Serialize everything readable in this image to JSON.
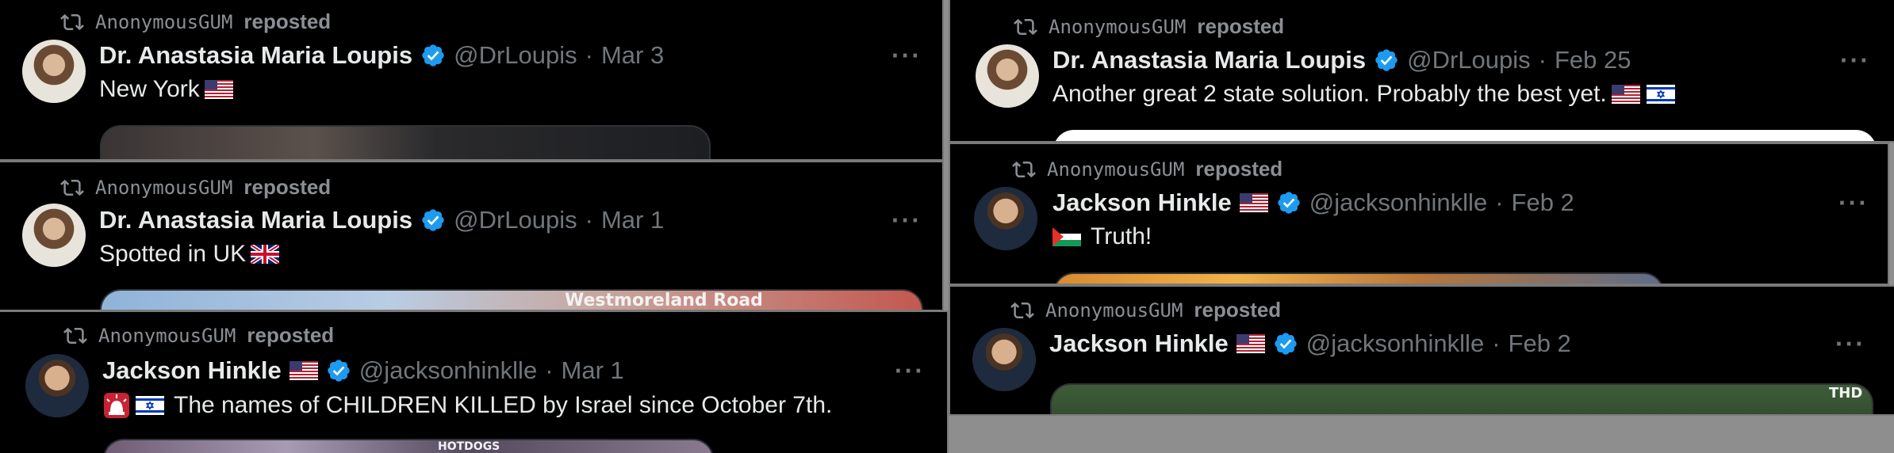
{
  "colors": {
    "background": "#000000",
    "name": "#e7e9ea",
    "secondary": "#71767b",
    "verified": "#1d9bf0"
  },
  "tweets": [
    {
      "reposter": "AnonymousGUM",
      "repost_label": "reposted",
      "author": "Dr. Anastasia Maria Loupis",
      "author_flag": "",
      "handle": "@DrLoupis",
      "separator": "·",
      "date": "Mar 3",
      "text": "New York",
      "text_flags": [
        "us-flag"
      ],
      "media_label": ""
    },
    {
      "reposter": "AnonymousGUM",
      "repost_label": "reposted",
      "author": "Dr. Anastasia Maria Loupis",
      "author_flag": "",
      "handle": "@DrLoupis",
      "separator": "·",
      "date": "Mar 1",
      "text": "Spotted in UK",
      "text_flags": [
        "uk-flag"
      ],
      "media_label": "Westmoreland Road"
    },
    {
      "reposter": "AnonymousGUM",
      "repost_label": "reposted",
      "author": "Jackson Hinkle",
      "author_flag": "us-flag",
      "handle": "@jacksonhinklle",
      "separator": "·",
      "date": "Mar 1",
      "text": "The names of CHILDREN KILLED by Israel since October 7th.",
      "text_flags": [
        "alarm-icon",
        "israel-flag"
      ],
      "media_label": "HOTDOGS"
    },
    {
      "reposter": "AnonymousGUM",
      "repost_label": "reposted",
      "author": "Dr. Anastasia Maria Loupis",
      "author_flag": "",
      "handle": "@DrLoupis",
      "separator": "·",
      "date": "Feb 25",
      "text": "Another great 2 state solution. Probably the best yet.",
      "text_flags": [
        "us-flag",
        "israel-flag"
      ],
      "media_label": ""
    },
    {
      "reposter": "AnonymousGUM",
      "repost_label": "reposted",
      "author": "Jackson Hinkle",
      "author_flag": "us-flag",
      "handle": "@jacksonhinklle",
      "separator": "·",
      "date": "Feb 2",
      "text": "Truth!",
      "text_flags": [
        "palestine-flag"
      ],
      "media_label": ""
    },
    {
      "reposter": "AnonymousGUM",
      "repost_label": "reposted",
      "author": "Jackson Hinkle",
      "author_flag": "us-flag",
      "handle": "@jacksonhinklle",
      "separator": "·",
      "date": "Feb 2",
      "text": "",
      "text_flags": [],
      "media_label": "THD"
    }
  ]
}
